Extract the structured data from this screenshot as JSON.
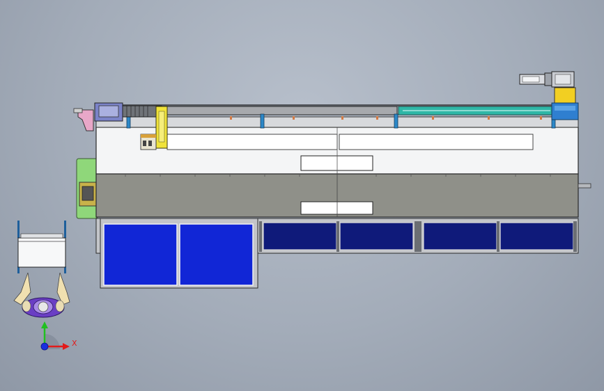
{
  "view": {
    "x_axis_label": "X"
  },
  "colors": {
    "background": "#a6afbc",
    "frame_white": "#f4f5f6",
    "frame_gray": "#8f9089",
    "panel_blue_bright": "#1126d6",
    "panel_blue_dark": "#0f1a7a",
    "rail_teal": "#2fb7a7",
    "carriage_yellow": "#f0e33a",
    "guard_green": "#8fd77a",
    "motor_gray": "#c9ccd2",
    "axis_x": "#e21b1b",
    "axis_y": "#20c020",
    "axis_z": "#1a2fe0"
  },
  "icons": {
    "operator": "person-top-view-icon",
    "triad": "xyz-axis-triad-icon"
  }
}
